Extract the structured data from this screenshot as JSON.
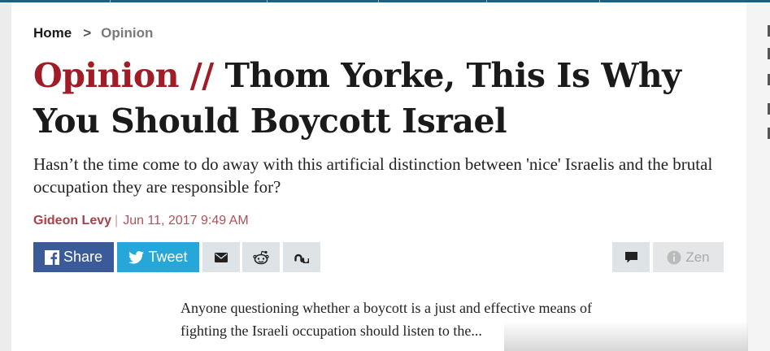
{
  "breadcrumb": {
    "home": "Home",
    "separator": ">",
    "current": "Opinion"
  },
  "article": {
    "section_label": "Opinion //",
    "title": "Thom Yorke, This Is Why You Should Boycott Israel",
    "subtitle": "Hasn’t the time come to do away with this artificial distinction between 'nice' Israelis and the brutal occupation they are responsible for?",
    "author": "Gideon Levy",
    "byline_separator": "|",
    "date": "Jun 11, 2017 9:49 AM",
    "excerpt": "Anyone questioning whether a boycott is a just and effective means of fighting the Israeli occupation should listen to the..."
  },
  "share_bar": {
    "facebook_label": "Share",
    "twitter_label": "Tweet",
    "zen_label": "Zen",
    "icons": [
      "facebook-icon",
      "twitter-icon",
      "mail-icon",
      "reddit-icon",
      "stumbleupon-icon",
      "comment-icon",
      "info-icon"
    ]
  },
  "colors": {
    "section_red": "#a01c26",
    "byline_red": "#a8414a",
    "facebook_blue": "#3b5a9a",
    "twitter_blue": "#25a8d9",
    "topbar_blue": "#1f5f84"
  }
}
